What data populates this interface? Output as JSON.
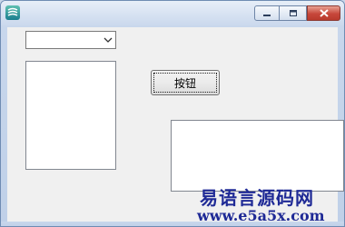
{
  "window": {
    "title": "",
    "app_icon": "app-logo-icon",
    "controls": {
      "minimize_icon": "minimize-icon",
      "maximize_icon": "maximize-icon",
      "close_icon": "close-icon"
    },
    "colors": {
      "close_button": "#c7473a",
      "titlebar": "#dbe6f4"
    }
  },
  "form": {
    "combo_value": "",
    "button_label": "按钮",
    "text_value": ""
  },
  "watermark": {
    "title": "易语言源码网",
    "url": "www.e5a5x.com",
    "color": "#1f2a96"
  }
}
